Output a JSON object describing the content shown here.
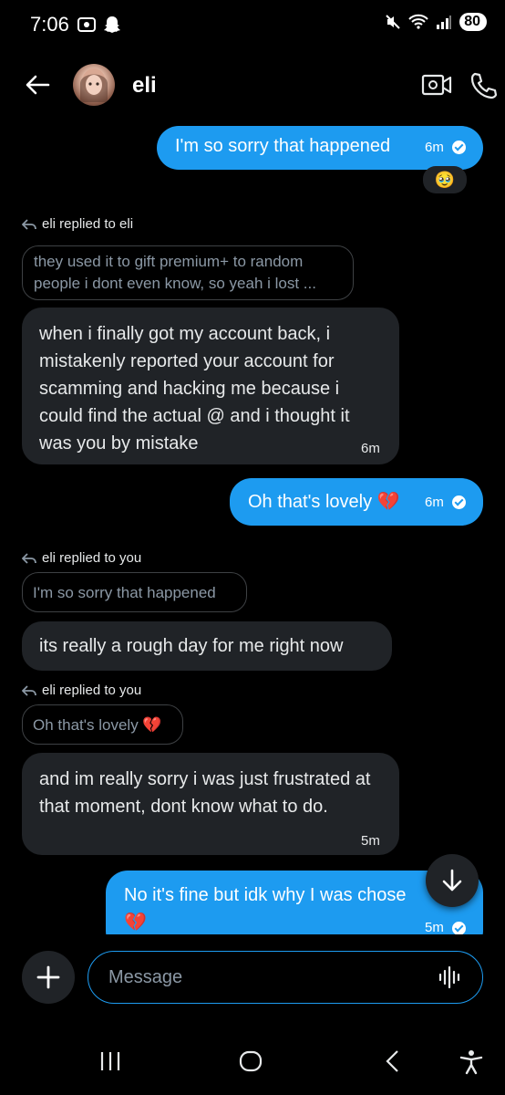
{
  "status_bar": {
    "time": "7:06",
    "battery": "80"
  },
  "header": {
    "contact_name": "eli"
  },
  "messages": [
    {
      "id": "m1",
      "text": "I'm so sorry that happened",
      "time": "6m",
      "reaction": "🥹"
    },
    {
      "id": "m2",
      "reply_label": "eli replied to eli",
      "quote": "they used it to gift premium+ to random people i dont even know, so yeah i lost ...",
      "text": "when i finally got my account back, i mistakenly reported your account for scamming and hacking me because i could find the actual @ and i thought it was you by mistake",
      "time": "6m"
    },
    {
      "id": "m3",
      "text": "Oh that's lovely 💔",
      "time": "6m"
    },
    {
      "id": "m4",
      "reply_label": "eli replied to you",
      "quote": "I'm so sorry that happened",
      "text": "its really a rough day for me right now"
    },
    {
      "id": "m5",
      "reply_label": "eli replied to you",
      "quote": "Oh that's lovely 💔",
      "text": "and im really sorry i was just frustrated at that moment, dont know what to do.",
      "time": "5m"
    },
    {
      "id": "m6",
      "text": "No it's fine but idk why I was chose",
      "text2": "💔",
      "time": "5m"
    }
  ],
  "composer": {
    "placeholder": "Message"
  }
}
